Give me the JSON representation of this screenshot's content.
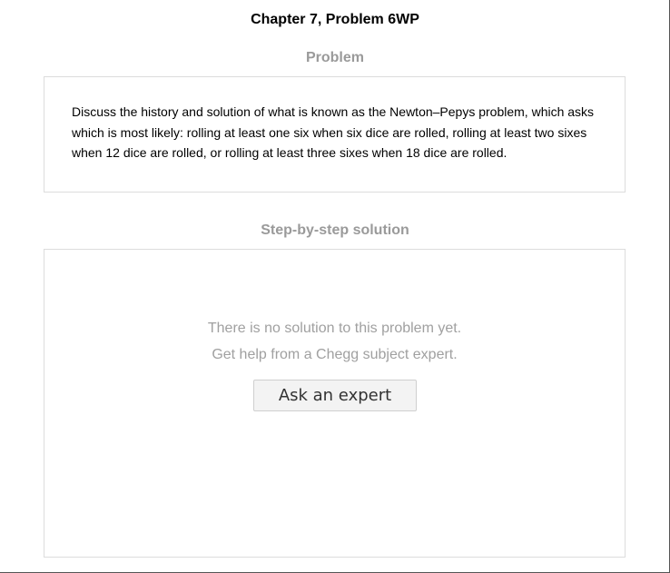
{
  "header": {
    "title": "Chapter 7, Problem 6WP"
  },
  "problem": {
    "label": "Problem",
    "text": "Discuss the history and solution of what is known as the Newton–Pepys problem, which asks which is most likely: rolling at least one six when six dice are rolled, rolling at least two sixes when 12 dice are rolled, or rolling at least three sixes when 18 dice are rolled."
  },
  "solution": {
    "label": "Step-by-step solution",
    "empty_message": "There is no solution to this problem yet.",
    "help_message": "Get help from a Chegg subject expert.",
    "ask_button_label": "Ask an expert"
  },
  "colors": {
    "muted_text": "#9a9a9a",
    "box_border": "#dcdcdc",
    "button_bg": "#f3f3f3"
  }
}
